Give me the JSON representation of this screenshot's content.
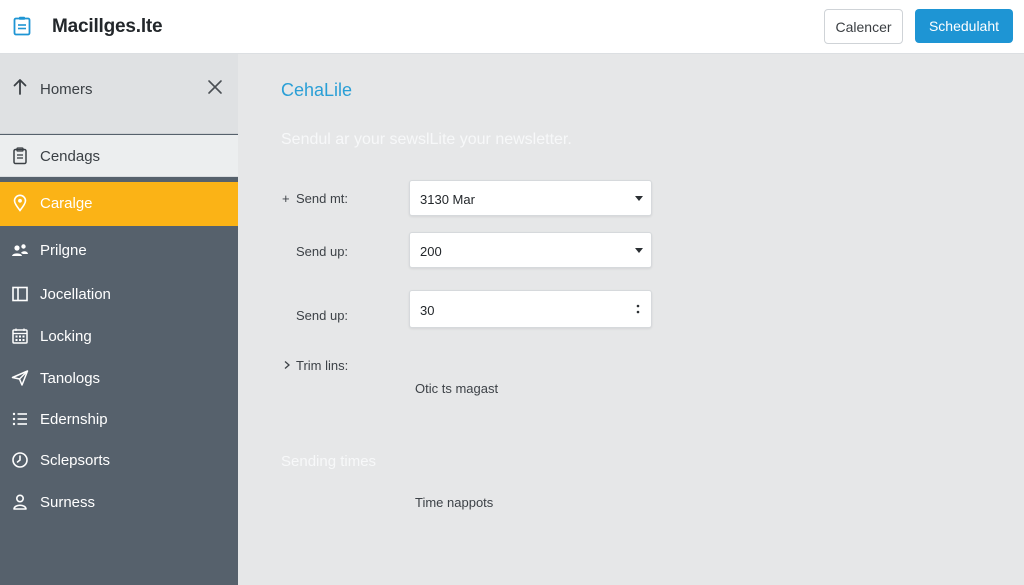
{
  "header": {
    "app_title": "Macillges.lte",
    "cancel_label": "Calencer",
    "schedule_label": "Schedulaht",
    "accent_color": "#1e95d4"
  },
  "sidebar": {
    "head_label": "Homers",
    "items": [
      {
        "label": "Cendags",
        "icon": "clipboard-icon",
        "state": "light"
      },
      {
        "label": "Caralge",
        "icon": "location-pin-icon",
        "state": "active"
      },
      {
        "label": "Prilgne",
        "icon": "users-icon",
        "state": "dark"
      },
      {
        "label": "Jocellation",
        "icon": "panel-icon",
        "state": "dark"
      },
      {
        "label": "Locking",
        "icon": "calendar-grid-icon",
        "state": "dark"
      },
      {
        "label": "Tanologs",
        "icon": "send-icon",
        "state": "dark"
      },
      {
        "label": "Edernship",
        "icon": "list-icon",
        "state": "dark"
      },
      {
        "label": "Sclepsorts",
        "icon": "clock-icon",
        "state": "dark"
      },
      {
        "label": "Surness",
        "icon": "user-icon",
        "state": "dark"
      }
    ],
    "active_color": "#fbb316"
  },
  "main": {
    "title": "CehaLile",
    "subtitle": "Sendul ar your sewslLite your newsletter.",
    "rows": [
      {
        "prefix": "+",
        "label": "Send mt:",
        "value": "3130 Mar",
        "control": "dropdown"
      },
      {
        "prefix": "",
        "label": "Send up:",
        "value": "200",
        "control": "dropdown"
      },
      {
        "prefix": "",
        "label": "Send up:",
        "value": "30",
        "control": "stepper"
      }
    ],
    "trim_label": "Trim lins:",
    "trim_value": "Otic ts magast",
    "section_title": "Sending times",
    "section_value": "Time nappots"
  }
}
